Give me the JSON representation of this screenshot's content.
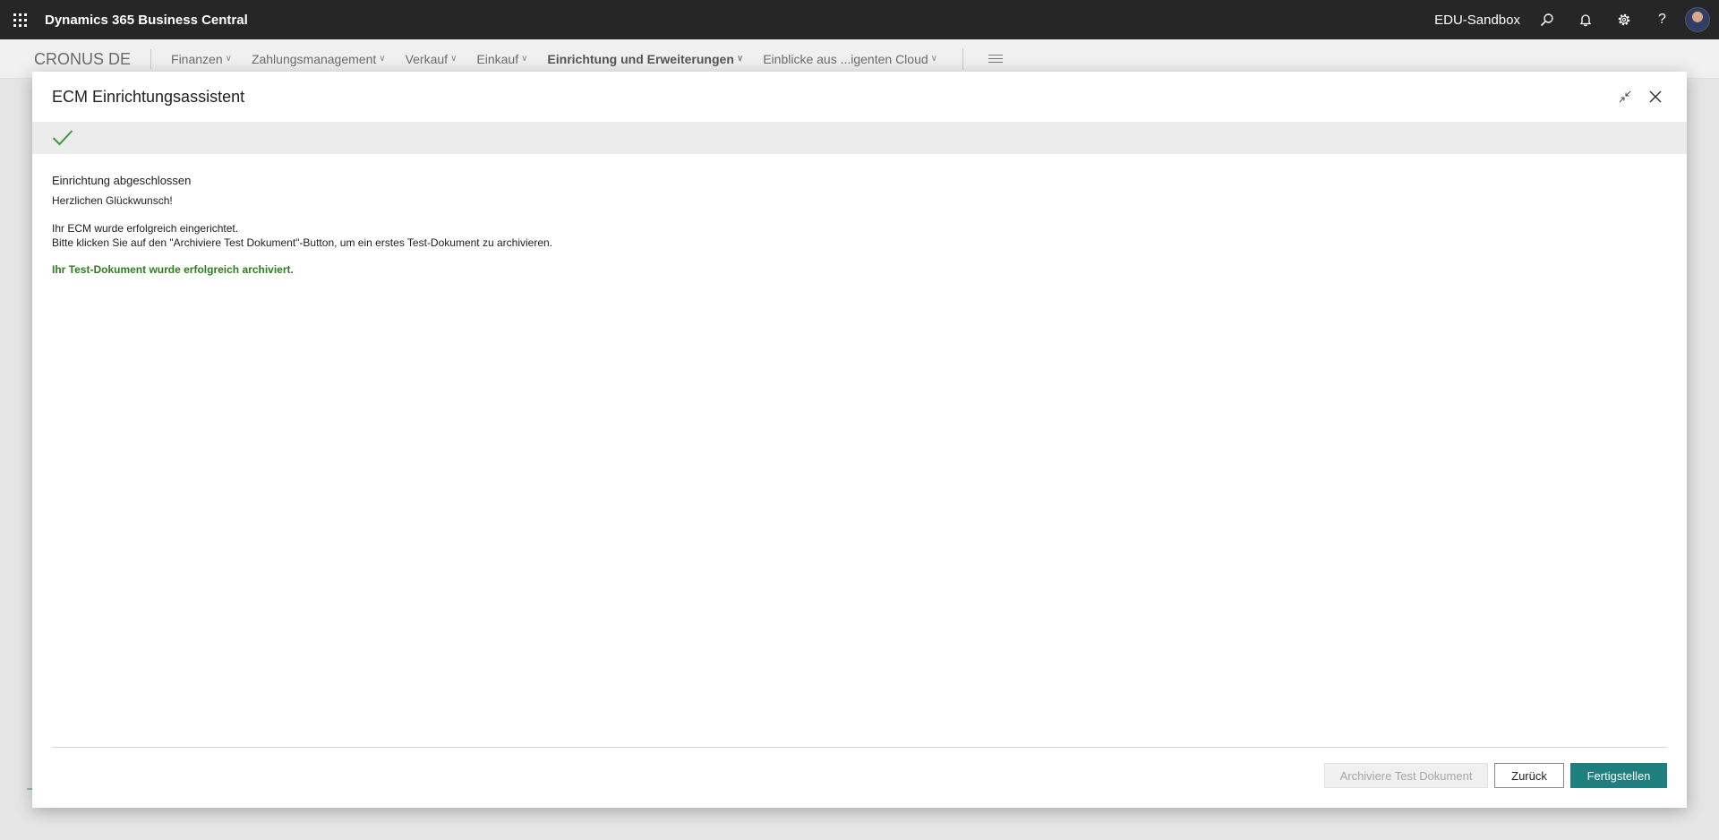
{
  "topbar": {
    "app_title": "Dynamics 365 Business Central",
    "environment": "EDU-Sandbox",
    "icons": [
      "app-launcher-icon",
      "search-icon",
      "bell-icon",
      "gear-icon",
      "help-icon"
    ],
    "help_glyph": "?"
  },
  "navigation": {
    "company": "CRONUS DE",
    "items": [
      {
        "label": "Finanzen"
      },
      {
        "label": "Zahlungsmanagement"
      },
      {
        "label": "Verkauf"
      },
      {
        "label": "Einkauf"
      },
      {
        "label": "Einrichtung und Erweiterungen"
      },
      {
        "label": "Einblicke aus ...igenten Cloud"
      }
    ],
    "chevron": "∨"
  },
  "dialog": {
    "title": "ECM Einrichtungsassistent",
    "content": {
      "heading": "Einrichtung abgeschlossen",
      "greeting": "Herzlichen Glückwunsch!",
      "line1": "Ihr ECM wurde erfolgreich eingerichtet.",
      "line2": "Bitte klicken Sie auf den \"Archiviere Test Dokument\"-Button, um ein erstes Test-Dokument zu archivieren.",
      "success": "Ihr Test-Dokument wurde erfolgreich archiviert."
    },
    "buttons": {
      "archive": "Archiviere Test Dokument",
      "back": "Zurück",
      "finish": "Fertigstellen"
    }
  },
  "colors": {
    "topbar": "#262626",
    "accent": "#1f7e7e",
    "success": "#2e7d1f",
    "step_check": "#3c9b3c"
  }
}
